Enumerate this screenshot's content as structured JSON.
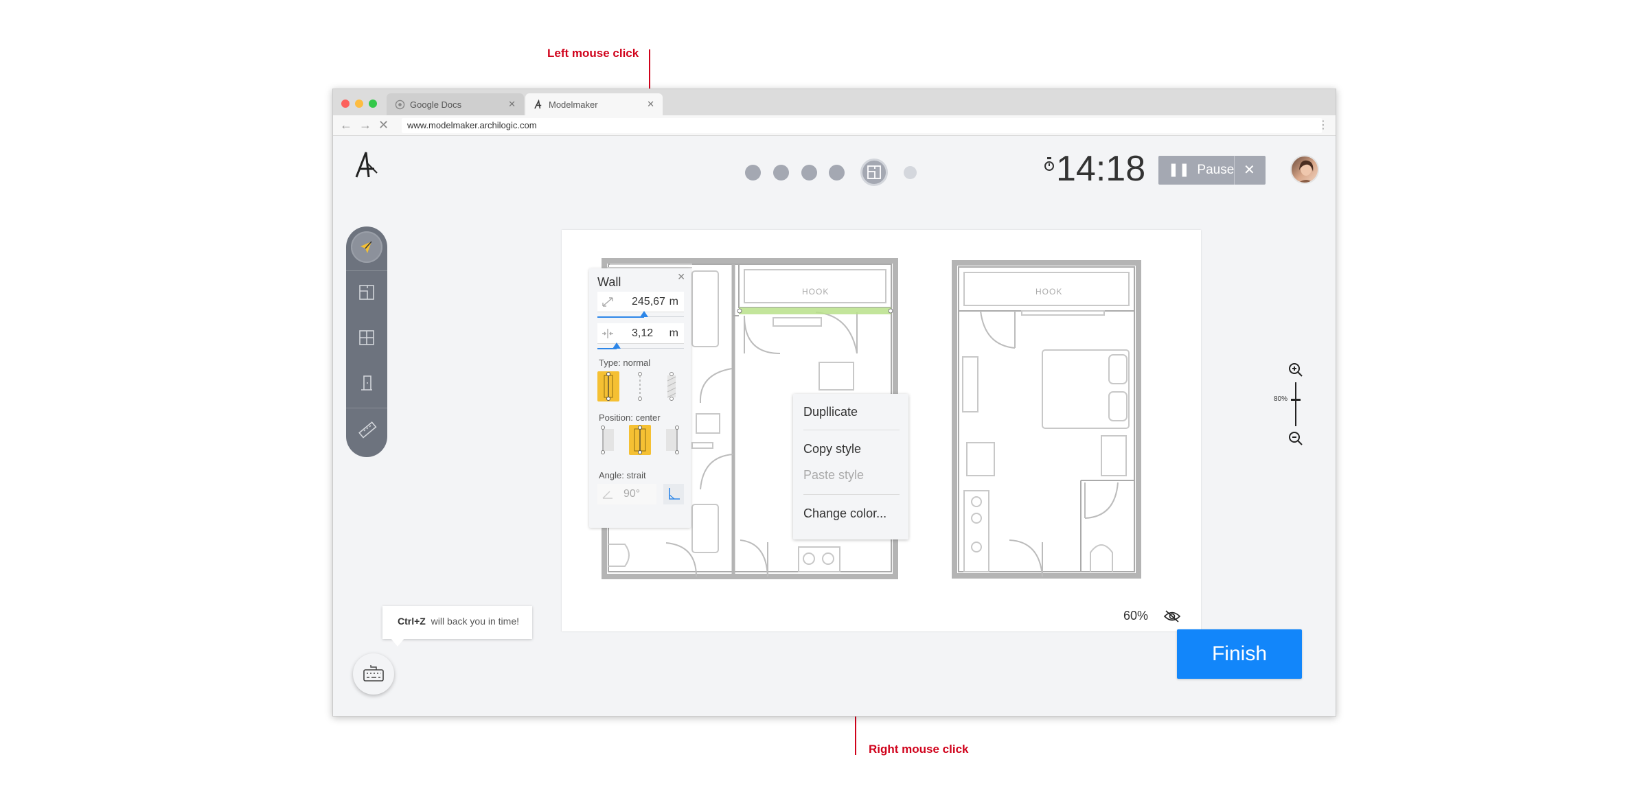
{
  "annotations": {
    "left_click": "Left mouse click",
    "right_click": "Right mouse click"
  },
  "browser": {
    "tabs": [
      {
        "title": "Google Docs",
        "icon": "google-docs-icon"
      },
      {
        "title": "Modelmaker",
        "icon": "archilogic-logo-icon"
      }
    ],
    "url": "www.modelmaker.archilogic.com"
  },
  "header": {
    "steps_total": 6,
    "active_step": 5,
    "timer": "14:18",
    "pause_label": "Pause"
  },
  "toolbar": {
    "tools": [
      "select-tool",
      "room-tool",
      "window-tool",
      "door-tool",
      "measure-tool"
    ],
    "active": "select-tool"
  },
  "canvas": {
    "room_label_1": "HOOK",
    "room_label_2": "HOOK",
    "zoom": "60%"
  },
  "wall_panel": {
    "title": "Wall",
    "length": "245,67",
    "length_unit": "m",
    "thickness": "3,12",
    "thickness_unit": "m",
    "type_label": "Type:  normal",
    "position_label": "Position:  center",
    "angle_label": "Angle: strait",
    "angle_value": "90°"
  },
  "context_menu": {
    "items": [
      "Dupllicate",
      "Copy style",
      "Paste style",
      "Change color..."
    ],
    "disabled": [
      "Paste style"
    ]
  },
  "zoom_control": {
    "level": "80%"
  },
  "tooltip": {
    "shortcut": "Ctrl+Z",
    "text": "will back you in time!"
  },
  "finish_label": "Finish",
  "colors": {
    "accent": "#1286fa",
    "annotation": "#d0021b",
    "selected_wall": "#b8e08a",
    "option_active": "#f5c033"
  }
}
